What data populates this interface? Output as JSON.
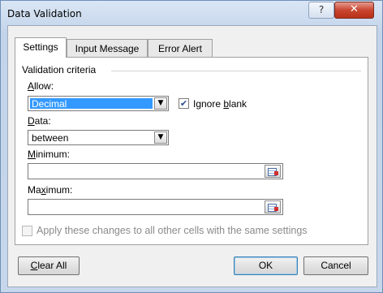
{
  "window": {
    "title": "Data Validation",
    "help_label": "?",
    "close_label": "✕"
  },
  "tabs": [
    {
      "label": "Settings",
      "active": true
    },
    {
      "label": "Input Message",
      "active": false
    },
    {
      "label": "Error Alert",
      "active": false
    }
  ],
  "settings": {
    "group_title": "Validation criteria",
    "allow": {
      "label_pre": "",
      "label_u": "A",
      "label_post": "llow:",
      "value": "Decimal"
    },
    "ignore_blank": {
      "label_pre": "Ignore ",
      "label_u": "b",
      "label_post": "lank",
      "checked": true
    },
    "data": {
      "label_pre": "",
      "label_u": "D",
      "label_post": "ata:",
      "value": "between"
    },
    "minimum": {
      "label_pre": "",
      "label_u": "M",
      "label_post": "inimum:",
      "value": ""
    },
    "maximum": {
      "label_pre": "Ma",
      "label_u": "x",
      "label_post": "imum:",
      "value": ""
    },
    "apply_all": {
      "label": "Apply these changes to all other cells with the same settings",
      "checked": false,
      "enabled": false
    }
  },
  "buttons": {
    "clear_pre": "",
    "clear_u": "C",
    "clear_post": "lear All",
    "ok": "OK",
    "cancel": "Cancel"
  },
  "icons": {
    "range_selector": "cell-range-select-icon",
    "dropdown": "chevron-down-icon",
    "check": "checkmark-icon"
  },
  "colors": {
    "selection": "#3399ff",
    "close_button": "#c9452f",
    "title_bar": "#c3d4ea"
  }
}
